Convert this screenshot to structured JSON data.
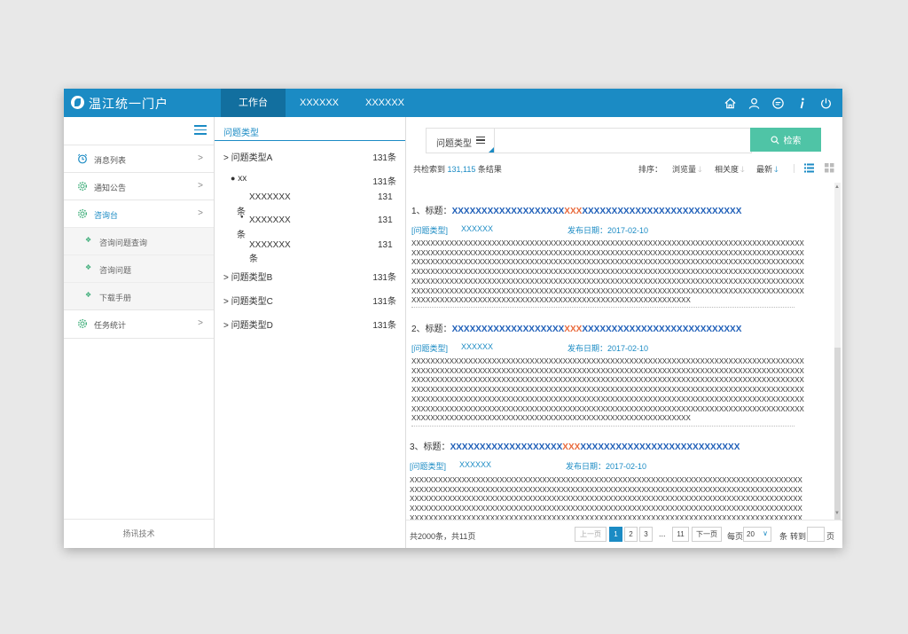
{
  "header": {
    "title": "温江统一门户",
    "tabs": [
      {
        "label": "工作台",
        "active": true
      },
      {
        "label": "XXXXXX",
        "active": false
      },
      {
        "label": "XXXXXX",
        "active": false
      }
    ],
    "icons": [
      "home-icon",
      "user-icon",
      "message-icon",
      "info-icon",
      "power-icon"
    ],
    "accent_color": "#1b8bc4"
  },
  "sidebar": {
    "items": [
      {
        "label": "消息列表",
        "icon": "alarm-clock-icon"
      },
      {
        "label": "通知公告",
        "icon": "gear-icon"
      },
      {
        "label": "咨询台",
        "icon": "gear-icon",
        "active": true
      },
      {
        "label": "任务统计",
        "icon": "gear-icon"
      }
    ],
    "subitems": [
      "咨询问题查询",
      "咨询问题",
      "下载手册"
    ],
    "footer": "扬讯技术"
  },
  "categories": {
    "header": "问题类型",
    "groups": [
      {
        "label": "> 问题类型A",
        "count": "131条"
      },
      {
        "label": "> 问题类型B",
        "count": "131条"
      },
      {
        "label": "> 问题类型C",
        "count": "131条"
      },
      {
        "label": "> 问题类型D",
        "count": "131条"
      }
    ],
    "xx": {
      "label": "xx",
      "count": "131条"
    },
    "subs": [
      {
        "label": "XXXXXXX",
        "count": "131",
        "unit": "条"
      },
      {
        "label": "XXXXXXX",
        "count": "131",
        "unit": "条"
      },
      {
        "label": "XXXXXXX",
        "count": "131",
        "unit": "条"
      }
    ]
  },
  "search": {
    "category_label": "问题类型",
    "placeholder": "",
    "button_label": "检索",
    "button_color": "#4fc4a6"
  },
  "results_summary": {
    "prefix": "共检索到",
    "count": "131,115",
    "suffix": "条结果"
  },
  "sort": {
    "label": "排序：",
    "options": [
      {
        "label": "浏览量",
        "active": false
      },
      {
        "label": "相关度",
        "active": false
      },
      {
        "label": "最新",
        "active": true
      }
    ]
  },
  "results": [
    {
      "prefix": "1、标题：",
      "title_a": "XXXXXXXXXXXXXXXXXXX",
      "highlight": "XXX",
      "title_b": "XXXXXXXXXXXXXXXXXXXXXXXXXXX",
      "type": "[问题类型]",
      "author": "XXXXXX",
      "date": "发布日期：2017-02-10",
      "body": "XXXXXXXXXXXXXXXXXXXXXXXXXXXXXXXXXXXXXXXXXXXXXXXXXXXXXXXXXXXXXXXXXXXXXXXXXXXXXXXXXXX\nXXXXXXXXXXXXXXXXXXXXXXXXXXXXXXXXXXXXXXXXXXXXXXXXXXXXXXXXXXXXXXXXXXXXXXXXXXXXXXXXXXX\nXXXXXXXXXXXXXXXXXXXXXXXXXXXXXXXXXXXXXXXXXXXXXXXXXXXXXXXXXXXXXXXXXXXXXXXXXXXXXXXXXXX\nXXXXXXXXXXXXXXXXXXXXXXXXXXXXXXXXXXXXXXXXXXXXXXXXXXXXXXXXXXXXXXXXXXXXXXXXXXXXXXXXXXX\nXXXXXXXXXXXXXXXXXXXXXXXXXXXXXXXXXXXXXXXXXXXXXXXXXXXXXXXXXXXXXXXXXXXXXXXXXXXXXXXXXXX\nXXXXXXXXXXXXXXXXXXXXXXXXXXXXXXXXXXXXXXXXXXXXXXXXXXXXXXXXXXXXXXXXXXXXXXXXXXXXXXXXXXX\nXXXXXXXXXXXXXXXXXXXXXXXXXXXXXXXXXXXXXXXXXXXXXXXXXXXXXXXXXXX"
    },
    {
      "prefix": "2、标题：",
      "title_a": "XXXXXXXXXXXXXXXXXXX",
      "highlight": "XXX",
      "title_b": "XXXXXXXXXXXXXXXXXXXXXXXXXXX",
      "type": "[问题类型]",
      "author": "XXXXXX",
      "date": "发布日期：2017-02-10",
      "body": "XXXXXXXXXXXXXXXXXXXXXXXXXXXXXXXXXXXXXXXXXXXXXXXXXXXXXXXXXXXXXXXXXXXXXXXXXXXXXXXXXXX\nXXXXXXXXXXXXXXXXXXXXXXXXXXXXXXXXXXXXXXXXXXXXXXXXXXXXXXXXXXXXXXXXXXXXXXXXXXXXXXXXXXX\nXXXXXXXXXXXXXXXXXXXXXXXXXXXXXXXXXXXXXXXXXXXXXXXXXXXXXXXXXXXXXXXXXXXXXXXXXXXXXXXXXXX\nXXXXXXXXXXXXXXXXXXXXXXXXXXXXXXXXXXXXXXXXXXXXXXXXXXXXXXXXXXXXXXXXXXXXXXXXXXXXXXXXXXX\nXXXXXXXXXXXXXXXXXXXXXXXXXXXXXXXXXXXXXXXXXXXXXXXXXXXXXXXXXXXXXXXXXXXXXXXXXXXXXXXXXXX\nXXXXXXXXXXXXXXXXXXXXXXXXXXXXXXXXXXXXXXXXXXXXXXXXXXXXXXXXXXXXXXXXXXXXXXXXXXXXXXXXXXX\nXXXXXXXXXXXXXXXXXXXXXXXXXXXXXXXXXXXXXXXXXXXXXXXXXXXXXXXXXXX"
    },
    {
      "prefix": "3、标题：",
      "title_a": "XXXXXXXXXXXXXXXXXXX",
      "highlight": "XXX",
      "title_b": "XXXXXXXXXXXXXXXXXXXXXXXXXXX",
      "type": "[问题类型]",
      "author": "XXXXXX",
      "date": "发布日期：2017-02-10",
      "body": "XXXXXXXXXXXXXXXXXXXXXXXXXXXXXXXXXXXXXXXXXXXXXXXXXXXXXXXXXXXXXXXXXXXXXXXXXXXXXXXXXXX\nXXXXXXXXXXXXXXXXXXXXXXXXXXXXXXXXXXXXXXXXXXXXXXXXXXXXXXXXXXXXXXXXXXXXXXXXXXXXXXXXXXX\nXXXXXXXXXXXXXXXXXXXXXXXXXXXXXXXXXXXXXXXXXXXXXXXXXXXXXXXXXXXXXXXXXXXXXXXXXXXXXXXXXXX\nXXXXXXXXXXXXXXXXXXXXXXXXXXXXXXXXXXXXXXXXXXXXXXXXXXXXXXXXXXXXXXXXXXXXXXXXXXXXXXXXXXX\nXXXXXXXXXXXXXXXXXXXXXXXXXXXXXXXXXXXXXXXXXXXXXXXXXXXXXXXXXXXXXXXXXXXXXXXXXXXXXXXXXXX"
    }
  ],
  "pagination": {
    "summary": "共2000条，共11页",
    "prev": "上一页",
    "pages": [
      "1",
      "2",
      "3"
    ],
    "ellipsis": "...",
    "last_page": "11",
    "next": "下一页",
    "per_page_label": "每页",
    "per_page": "20",
    "unit": "条",
    "goto_label": "转到",
    "page_unit": "页"
  }
}
